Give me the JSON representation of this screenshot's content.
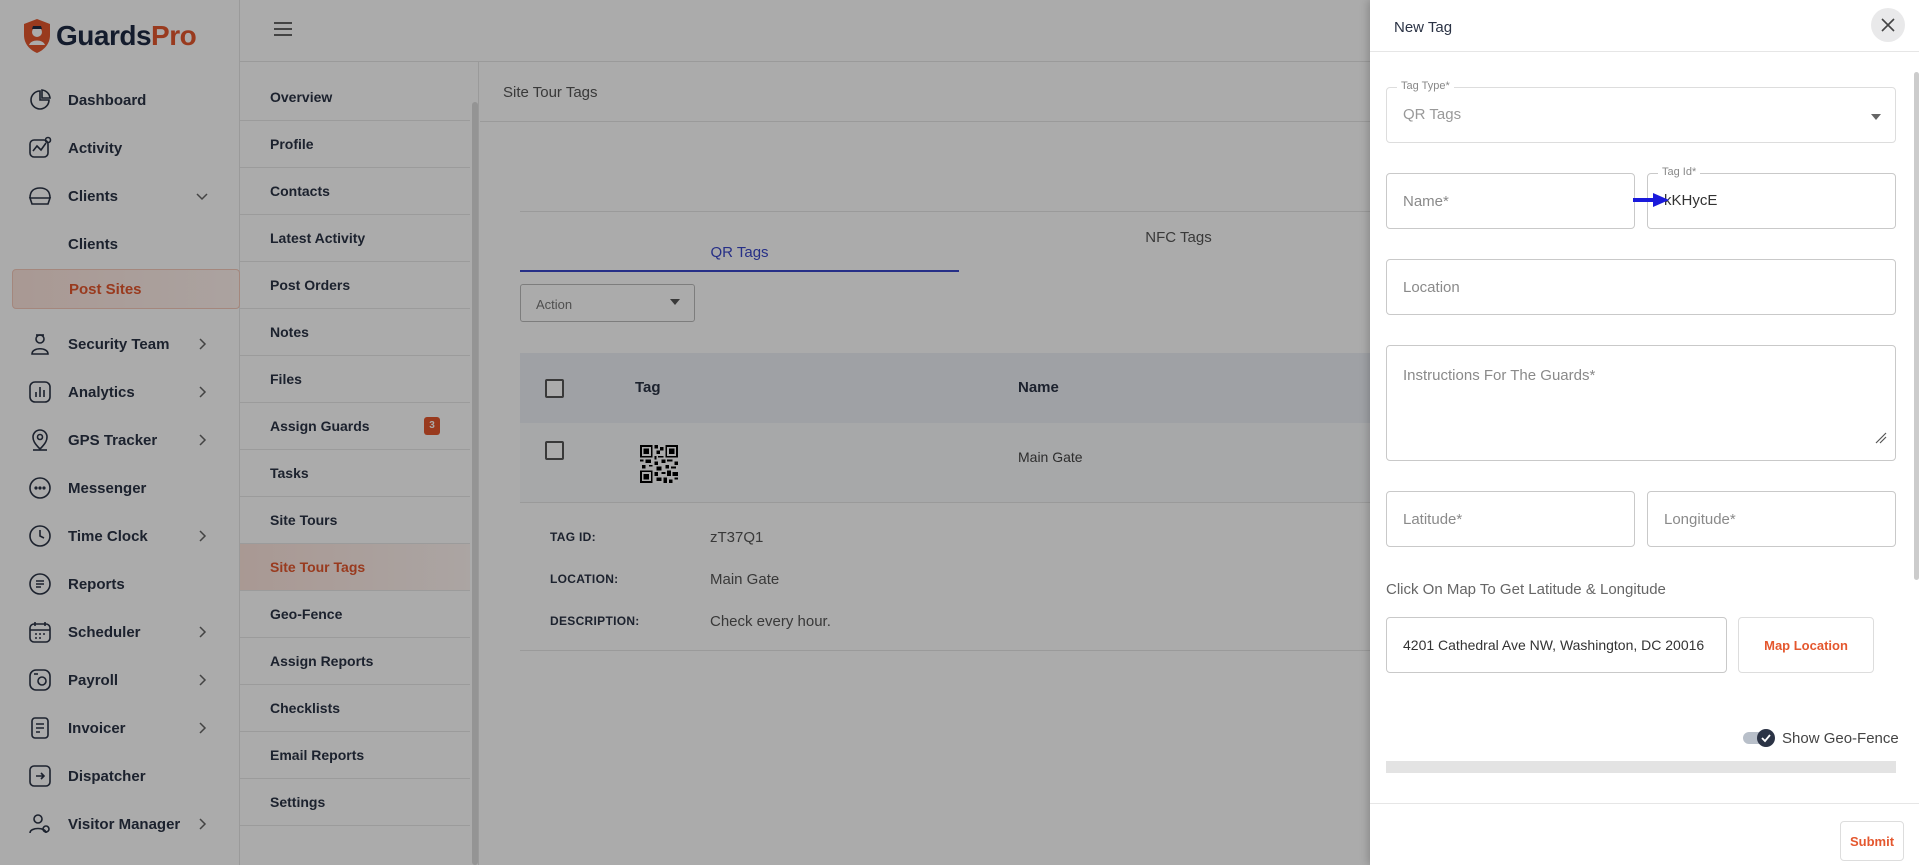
{
  "app": {
    "brand_main": "Guards",
    "brand_accent": "Pro",
    "accent_color": "#e4572e",
    "link_color": "#3a47c9"
  },
  "sidebar": {
    "items": [
      {
        "label": "Dashboard",
        "icon": "dashboard-icon"
      },
      {
        "label": "Activity",
        "icon": "activity-icon"
      },
      {
        "label": "Clients",
        "icon": "clients-icon",
        "expanded": true
      },
      {
        "label": "Security Team",
        "icon": "security-team-icon"
      },
      {
        "label": "Analytics",
        "icon": "analytics-icon"
      },
      {
        "label": "GPS Tracker",
        "icon": "gps-icon"
      },
      {
        "label": "Messenger",
        "icon": "messenger-icon"
      },
      {
        "label": "Time Clock",
        "icon": "clock-icon"
      },
      {
        "label": "Reports",
        "icon": "reports-icon"
      },
      {
        "label": "Scheduler",
        "icon": "calendar-icon"
      },
      {
        "label": "Payroll",
        "icon": "payroll-icon"
      },
      {
        "label": "Invoicer",
        "icon": "invoice-icon"
      },
      {
        "label": "Dispatcher",
        "icon": "dispatcher-icon"
      },
      {
        "label": "Visitor Manager",
        "icon": "visitor-icon"
      }
    ],
    "sub_items": [
      {
        "label": "Clients"
      },
      {
        "label": "Post Sites",
        "active": true
      }
    ]
  },
  "submenu": {
    "items": [
      {
        "label": "Overview"
      },
      {
        "label": "Profile"
      },
      {
        "label": "Contacts"
      },
      {
        "label": "Latest Activity"
      },
      {
        "label": "Post Orders"
      },
      {
        "label": "Notes"
      },
      {
        "label": "Files"
      },
      {
        "label": "Assign Guards",
        "badge": "3"
      },
      {
        "label": "Tasks"
      },
      {
        "label": "Site Tours"
      },
      {
        "label": "Site Tour Tags",
        "active": true
      },
      {
        "label": "Geo-Fence"
      },
      {
        "label": "Assign Reports"
      },
      {
        "label": "Checklists"
      },
      {
        "label": "Email Reports"
      },
      {
        "label": "Settings"
      }
    ]
  },
  "main": {
    "title": "Site Tour Tags",
    "tabs": [
      "QR Tags",
      "NFC Tags"
    ],
    "action_label": "Action",
    "table": {
      "headers": [
        "Tag",
        "Name"
      ],
      "row": {
        "name": "Main Gate"
      }
    },
    "details": {
      "tag_id_label": "TAG ID:",
      "tag_id": "zT37Q1",
      "location_label": "LOCATION:",
      "location": "Main Gate",
      "description_label": "DESCRIPTION:",
      "description": "Check every hour."
    }
  },
  "drawer": {
    "title": "New Tag",
    "tag_type_label": "Tag Type*",
    "tag_type_value": "QR Tags",
    "name_placeholder": "Name*",
    "tag_id_label": "Tag Id*",
    "tag_id_value": "kKHycE",
    "location_placeholder": "Location",
    "instructions_placeholder": "Instructions For The Guards*",
    "latitude_placeholder": "Latitude*",
    "longitude_placeholder": "Longitude*",
    "map_hint": "Click On Map To Get Latitude & Longitude",
    "address_value": "4201 Cathedral Ave NW, Washington, DC 20016",
    "map_location_button": "Map Location",
    "geofence_label": "Show Geo-Fence",
    "geofence_on": true,
    "submit_label": "Submit"
  }
}
